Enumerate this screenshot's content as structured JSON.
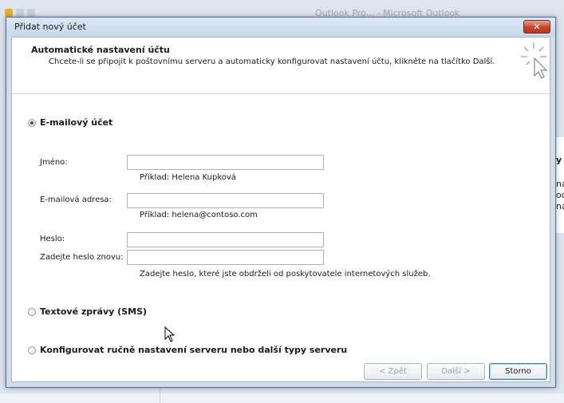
{
  "background_window": {
    "title": "Outlook Pro... - Microsoft Outlook",
    "pane_text_lines": [
      "y",
      "ná",
      "oc",
      "ná"
    ]
  },
  "dialog": {
    "title": "Přidat nový účet",
    "close_glyph": "✕",
    "header": {
      "title": "Automatické nastavení účtu",
      "description": "Chcete-li se připojit k poštovnímu serveru a automaticky konfigurovat nastavení účtu, klikněte na tlačítko Další."
    },
    "options": {
      "email_account": "E-mailový účet",
      "sms": "Textové zprávy (SMS)",
      "manual": "Konfigurovat ručně nastavení serveru nebo další typy serveru"
    },
    "selected_option": "email_account",
    "fields": {
      "name": {
        "label": "Jméno:",
        "value": "",
        "hint": "Příklad: Helena Kupková"
      },
      "email": {
        "label": "E-mailová adresa:",
        "value": "",
        "hint": "Příklad: helena@contoso.com"
      },
      "password": {
        "label": "Heslo:",
        "value": ""
      },
      "password_confirm": {
        "label": "Zadejte heslo znovu:",
        "value": "",
        "hint": "Zadejte heslo, které jste obdrželi od poskytovatele internetových služeb."
      }
    },
    "buttons": {
      "back": "< Zpět",
      "next": "Další >",
      "cancel": "Storno"
    }
  },
  "colors": {
    "dialog_frame": "#cfdcec",
    "close_button": "#c7442a",
    "primary_button_border": "#3c7fb1"
  }
}
